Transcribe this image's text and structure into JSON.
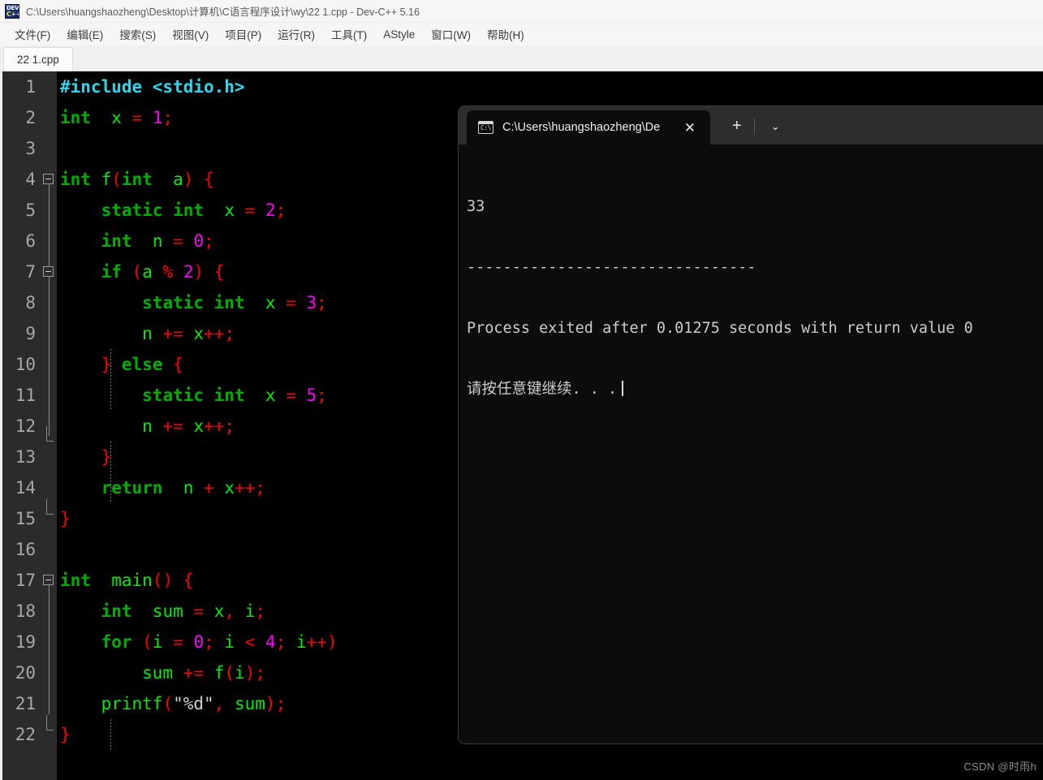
{
  "window": {
    "icon": "devcpp-icon",
    "icon_line1": "DEV",
    "icon_line2": "C++",
    "title": "C:\\Users\\huangshaozheng\\Desktop\\计算机\\C语言程序设计\\wy\\22 1.cpp - Dev-C++ 5.16"
  },
  "menubar": {
    "items": [
      {
        "label": "文件(F)"
      },
      {
        "label": "编辑(E)"
      },
      {
        "label": "搜索(S)"
      },
      {
        "label": "视图(V)"
      },
      {
        "label": "项目(P)"
      },
      {
        "label": "运行(R)"
      },
      {
        "label": "工具(T)"
      },
      {
        "label": "AStyle"
      },
      {
        "label": "窗口(W)"
      },
      {
        "label": "帮助(H)"
      }
    ]
  },
  "editor": {
    "tab_label": "22 1.cpp",
    "line_numbers": [
      "1",
      "2",
      "3",
      "4",
      "5",
      "6",
      "7",
      "8",
      "9",
      "10",
      "11",
      "12",
      "13",
      "14",
      "15",
      "16",
      "17",
      "18",
      "19",
      "20",
      "21",
      "22"
    ],
    "code_lines": [
      "#include <stdio.h>",
      "int  x = 1;",
      "",
      "int f(int  a) {",
      "    static int  x = 2;",
      "    int  n = 0;",
      "    if (a % 2) {",
      "        static int  x = 3;",
      "        n += x++;",
      "    } else {",
      "        static int  x = 5;",
      "        n += x++;",
      "    }",
      "    return  n + x++;",
      "}",
      "",
      "int  main() {",
      "    int  sum = x, i;",
      "    for (i = 0; i < 4; i++)",
      "        sum += f(i);",
      "    printf(\"%d\", sum);",
      "}"
    ],
    "fold_markers": [
      "4",
      "7",
      "17"
    ],
    "colors": {
      "background": "#000000",
      "gutter_background": "#2b2b2b",
      "line_number": "#a8a8a8",
      "keyword": "#00b000",
      "identifier": "#00ee00",
      "punctuation": "#ff0000",
      "number": "#ff00ff",
      "preprocessor": "#30d6e8",
      "string": "#d0d0d0"
    }
  },
  "terminal": {
    "tab_icon": "command-prompt-icon",
    "tab_icon_text": "C:\\",
    "tab_title": "C:\\Users\\huangshaozheng\\De",
    "close_label": "✕",
    "newtab_label": "+",
    "chevron_label": "⌄",
    "output_lines": [
      "33",
      "--------------------------------",
      "Process exited after 0.01275 seconds with return value 0",
      "请按任意键继续. . ."
    ],
    "colors": {
      "titlebar": "#2d2d2d",
      "background": "#0c0c0c",
      "text": "#cccccc"
    }
  },
  "watermark": {
    "text": "CSDN @时雨h"
  }
}
